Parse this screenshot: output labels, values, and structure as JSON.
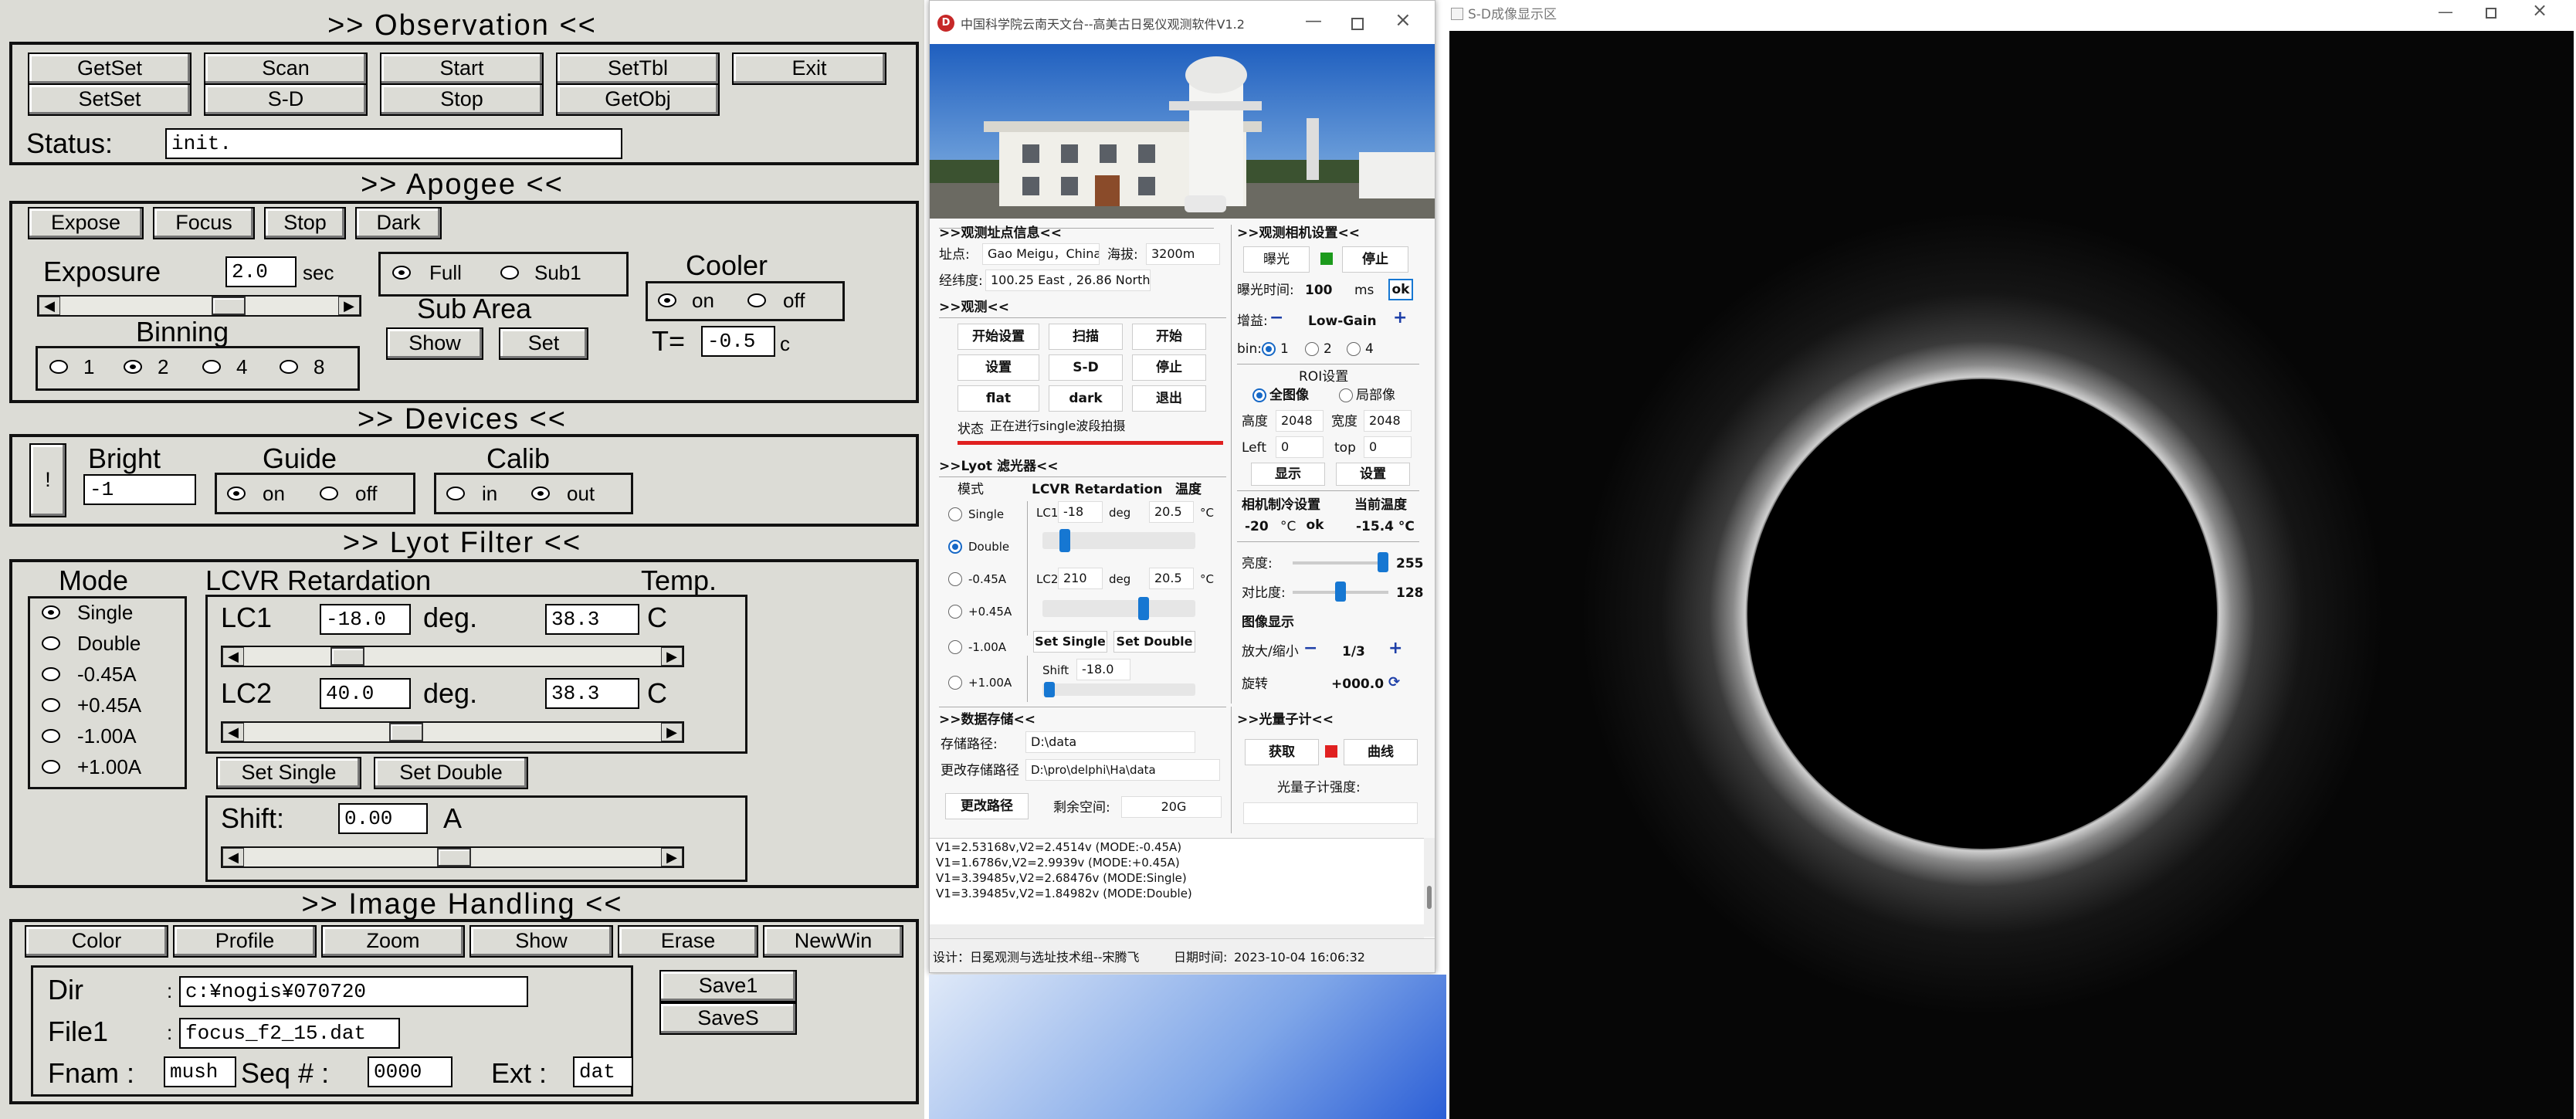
{
  "observation": {
    "header": ">> Observation <<",
    "buttons_row1": [
      "GetSet",
      "Scan",
      "Start",
      "SetTbl",
      "Exit"
    ],
    "buttons_row2": [
      "SetSet",
      "S-D",
      "Stop",
      "GetObj"
    ],
    "status_label": "Status:",
    "status_value": "init."
  },
  "apogee": {
    "header": ">> Apogee <<",
    "buttons": [
      "Expose",
      "Focus",
      "Stop",
      "Dark"
    ],
    "exposure_label": "Exposure",
    "exposure_value": "2.0",
    "exposure_unit": "sec",
    "binning_label": "Binning",
    "binning_options": [
      "1",
      "2",
      "4",
      "8"
    ],
    "binning_selected": "2",
    "mode_options": [
      "Full",
      "Sub1"
    ],
    "mode_selected": "Full",
    "subarea_label": "Sub Area",
    "show_label": "Show",
    "set_label": "Set",
    "cooler_label": "Cooler",
    "cooler_options": [
      "on",
      "off"
    ],
    "cooler_selected": "on",
    "temp_label": "T=",
    "temp_value": "-0.5",
    "temp_unit": "c"
  },
  "devices": {
    "header": ">> Devices <<",
    "toggle_glyph": "!",
    "bright_label": "Bright",
    "bright_value": "-1",
    "guide_label": "Guide",
    "guide_options": [
      "on",
      "off"
    ],
    "guide_selected": "on",
    "calib_label": "Calib",
    "calib_options": [
      "in",
      "out"
    ],
    "calib_selected": "out"
  },
  "lyot": {
    "header": ">> Lyot Filter <<",
    "mode_label": "Mode",
    "mode_options": [
      "Single",
      "Double",
      "-0.45A",
      "+0.45A",
      "-1.00A",
      "+1.00A"
    ],
    "mode_selected": "Single",
    "lcvr_label": "LCVR Retardation",
    "temp_label": "Temp.",
    "lc1_label": "LC1",
    "lc1_value": "-18.0",
    "lc1_unit": "deg.",
    "lc1_temp": "38.3",
    "lc1_temp_unit": "C",
    "lc2_label": "LC2",
    "lc2_value": "40.0",
    "lc2_unit": "deg.",
    "lc2_temp": "38.3",
    "lc2_temp_unit": "C",
    "set_single": "Set Single",
    "set_double": "Set Double",
    "shift_label": "Shift:",
    "shift_value": "0.00",
    "shift_unit": "A"
  },
  "image_handling": {
    "header": ">> Image Handling <<",
    "buttons": [
      "Color",
      "Profile",
      "Zoom",
      "Show",
      "Erase",
      "NewWin"
    ],
    "dir_label": "Dir",
    "dir_value": "c:¥nogis¥070720",
    "file1_label": "File1",
    "file1_value": "focus_f2_15.dat",
    "fnam_label": "Fnam :",
    "fnam_value": "mush",
    "seq_label": "Seq # :",
    "seq_value": "0000",
    "ext_label": "Ext :",
    "ext_value": "dat",
    "save1": "Save1",
    "saves": "SaveS"
  },
  "win": {
    "title": "中国科学院云南天文台--高美古日冕仪观测软件V1.2",
    "site_header": ">>观测址点信息<<",
    "site_label": "址点:",
    "site_value": "Gao Meigu，China",
    "alt_label": "海拔:",
    "alt_value": "3200m",
    "coord_label": "经纬度:",
    "coord_value": "100.25 East , 26.86 North",
    "obs_header": ">>观测<<",
    "obs_buttons": [
      "开始设置",
      "扫描",
      "开始",
      "设置",
      "S-D",
      "停止",
      "flat",
      "dark",
      "退出"
    ],
    "status_label": "状态",
    "status_value": "正在进行single波段拍摄",
    "lyot_header": ">>Lyot 滤光器<<",
    "mode_label": "模式",
    "mode_options": [
      "Single",
      "Double",
      "-0.45A",
      "+0.45A",
      "-1.00A",
      "+1.00A"
    ],
    "mode_selected": "Double",
    "lcvr_label": "LCVR Retardation",
    "temp_label": "温度",
    "lc1_label": "LC1",
    "lc1_value": "-18",
    "lc2_label": "LC2",
    "lc2_value": "210",
    "deg": "deg",
    "t1": "20.5",
    "t2": "20.5",
    "tu": "°C",
    "set_single": "Set Single",
    "set_double": "Set Double",
    "shift_label": "Shift",
    "shift_value": "-18.0",
    "cam_header": ">>观测相机设置<<",
    "expose_btn": "曝光",
    "stop_btn": "停止",
    "exptime_label": "曝光时间:",
    "exptime_value": "100",
    "exptime_unit": "ms",
    "ok": "ok",
    "gain_label": "增益:",
    "gain_value": "Low-Gain",
    "minus": "−",
    "plus": "+",
    "bin_label": "bin:",
    "bin_options": [
      "1",
      "2",
      "4"
    ],
    "bin_selected": "1",
    "roi_header": "ROI设置",
    "roi_full": "全图像",
    "roi_part": "局部像",
    "height_label": "高度",
    "height_value": "2048",
    "width_label": "宽度",
    "width_value": "2048",
    "left_label": "Left",
    "left_value": "0",
    "top_label": "top",
    "top_value": "0",
    "show_btn": "显示",
    "set_btn": "设置",
    "cool_label": "相机制冷设置",
    "cur_temp_label": "当前温度",
    "cool_value": "-20",
    "cool_unit": "°C",
    "cur_temp_value": "-15.4 °C",
    "bright_label": "亮度:",
    "bright_value": "255",
    "bright_level": 1.0,
    "contrast_label": "对比度:",
    "contrast_value": "128",
    "contrast_level": 0.5,
    "disp_header": "图像显示",
    "zoom_label": "放大/缩小",
    "zoom_value": "1/3",
    "rot_label": "旋转",
    "rot_value": "+000.0",
    "store_header": ">>数据存储<<",
    "path_label": "存储路径:",
    "path_value": "D:\\data",
    "change_label": "更改存储路径",
    "change_value": "D:\\pro\\delphi\\Ha\\data",
    "change_btn": "更改路径",
    "space_label": "剩余空间:",
    "space_value": "20G",
    "photon_header": ">>光量子计<<",
    "get_btn": "获取",
    "curve_btn": "曲线",
    "photon_label": "光量子计强度:",
    "log": [
      "V1=2.53168v,V2=2.4514v  (MODE:-0.45A)",
      "V1=1.6786v,V2=2.9939v  (MODE:+0.45A)",
      "V1=3.39485v,V2=2.68476v  (MODE:Single)",
      "V1=3.39485v,V2=1.84982v  (MODE:Double)"
    ],
    "footer_design": "设计：日冕观测与选址技术组--宋腾飞",
    "footer_date_label": "日期时间:",
    "footer_date": "2023-10-04  16:06:32"
  },
  "right": {
    "title": "S-D成像显示区"
  },
  "colors": {
    "panel_bg": "#dcdcd6",
    "dark_bg": "#060606",
    "accent_blue": "#1677d2",
    "status_red": "#e02020",
    "led_green": "#1c9a1c",
    "led_red": "#e02020"
  }
}
